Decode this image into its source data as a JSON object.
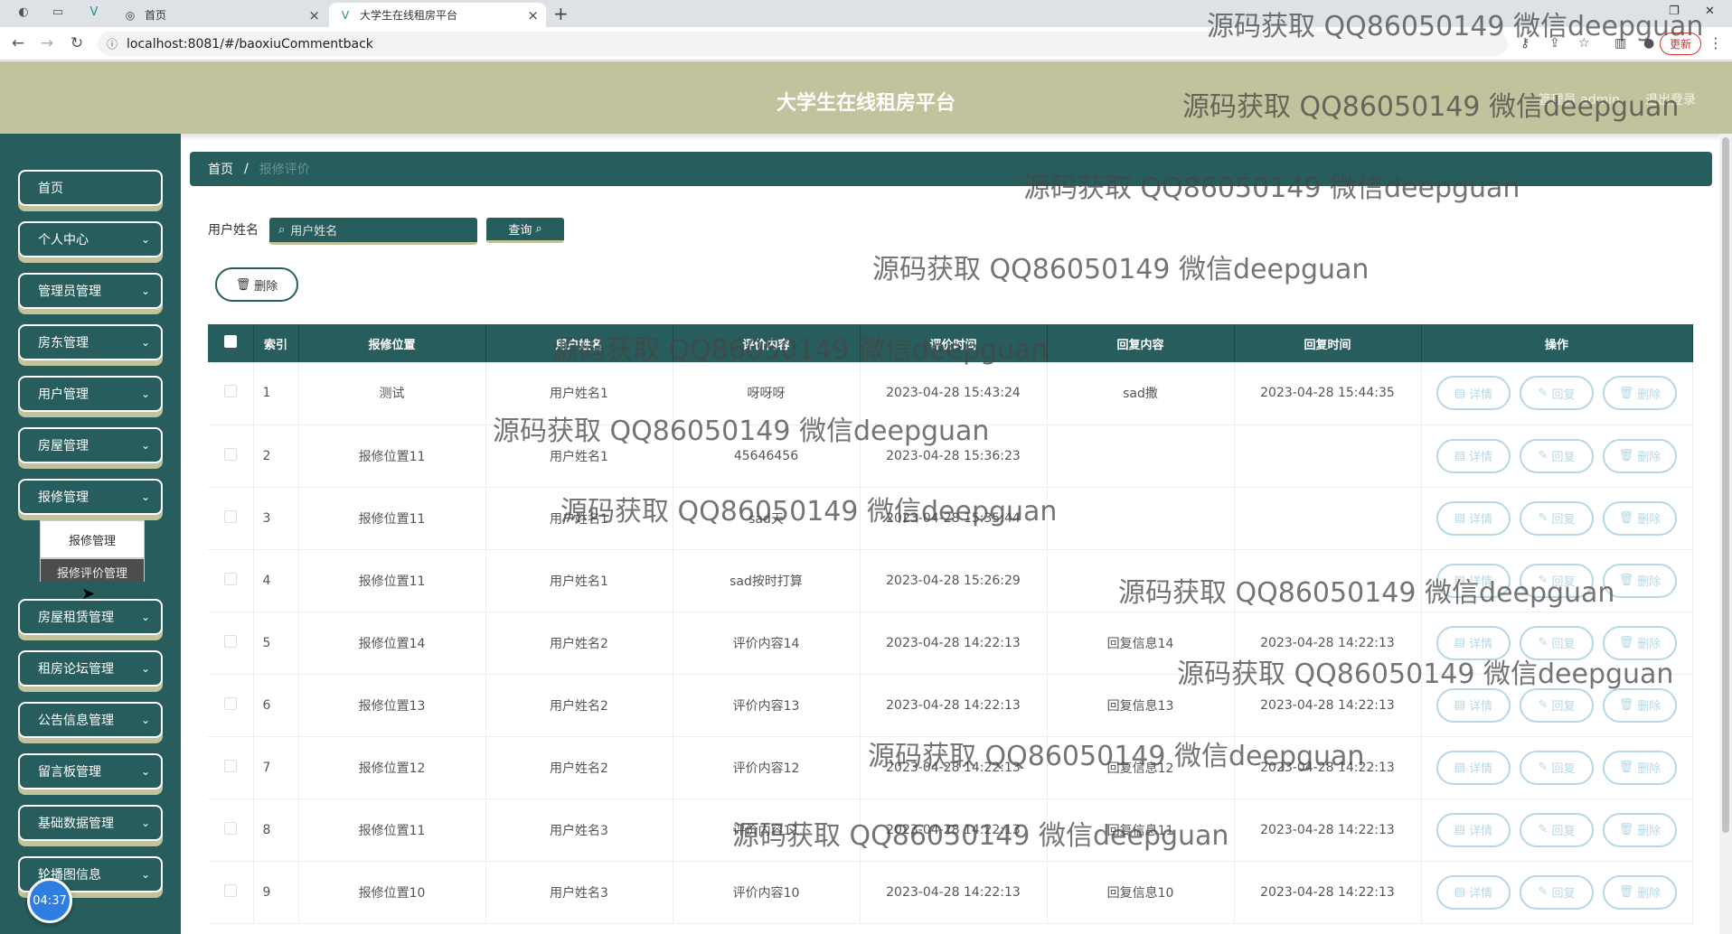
{
  "browser": {
    "tabs": [
      {
        "title": "首页",
        "active": false
      },
      {
        "title": "大学生在线租房平台",
        "active": true
      }
    ],
    "url": "localhost:8081/#/baoxiuCommentback",
    "update_label": "更新"
  },
  "header": {
    "title": "大学生在线租房平台",
    "links": [
      "管理员 admin",
      "退出登录"
    ]
  },
  "sidebar": {
    "items": [
      {
        "label": "首页",
        "has_arrow": false
      },
      {
        "label": "个人中心",
        "has_arrow": true
      },
      {
        "label": "管理员管理",
        "has_arrow": true
      },
      {
        "label": "房东管理",
        "has_arrow": true
      },
      {
        "label": "用户管理",
        "has_arrow": true
      },
      {
        "label": "房屋管理",
        "has_arrow": true
      },
      {
        "label": "报修管理",
        "has_arrow": true
      },
      {
        "label": "房屋租赁管理",
        "has_arrow": true
      },
      {
        "label": "租房论坛管理",
        "has_arrow": true
      },
      {
        "label": "公告信息管理",
        "has_arrow": true
      },
      {
        "label": "留言板管理",
        "has_arrow": true
      },
      {
        "label": "基础数据管理",
        "has_arrow": true
      },
      {
        "label": "轮播图信息",
        "has_arrow": true
      }
    ],
    "submenu": [
      "报修管理",
      "报修评价管理"
    ],
    "timer": "04:37"
  },
  "breadcrumb": {
    "home": "首页",
    "separator": "/",
    "current": "报修评价"
  },
  "search": {
    "label": "用户姓名",
    "placeholder": "用户姓名",
    "button": "查询"
  },
  "toolbar": {
    "delete_label": "删除"
  },
  "table": {
    "columns": [
      "索引",
      "报修位置",
      "用户姓名",
      "评价内容",
      "评价时间",
      "回复内容",
      "回复时间",
      "操作"
    ],
    "actions": [
      "详情",
      "回复",
      "删除"
    ],
    "rows": [
      {
        "idx": "1",
        "location": "测试",
        "user": "用户姓名1",
        "content": "呀呀呀",
        "time": "2023-04-28 15:43:24",
        "reply": "sad撒",
        "reply_time": "2023-04-28 15:44:35"
      },
      {
        "idx": "2",
        "location": "报修位置11",
        "user": "用户姓名1",
        "content": "45646456",
        "time": "2023-04-28 15:36:23",
        "reply": "",
        "reply_time": ""
      },
      {
        "idx": "3",
        "location": "报修位置11",
        "user": "用户姓名1",
        "content": "sad天",
        "time": "2023-04-28 15:35:44",
        "reply": "",
        "reply_time": ""
      },
      {
        "idx": "4",
        "location": "报修位置11",
        "user": "用户姓名1",
        "content": "sad按时打算",
        "time": "2023-04-28 15:26:29",
        "reply": "",
        "reply_time": ""
      },
      {
        "idx": "5",
        "location": "报修位置14",
        "user": "用户姓名2",
        "content": "评价内容14",
        "time": "2023-04-28 14:22:13",
        "reply": "回复信息14",
        "reply_time": "2023-04-28 14:22:13"
      },
      {
        "idx": "6",
        "location": "报修位置13",
        "user": "用户姓名2",
        "content": "评价内容13",
        "time": "2023-04-28 14:22:13",
        "reply": "回复信息13",
        "reply_time": "2023-04-28 14:22:13"
      },
      {
        "idx": "7",
        "location": "报修位置12",
        "user": "用户姓名2",
        "content": "评价内容12",
        "time": "2023-04-28 14:22:13",
        "reply": "回复信息12",
        "reply_time": "2023-04-28 14:22:13"
      },
      {
        "idx": "8",
        "location": "报修位置11",
        "user": "用户姓名3",
        "content": "评价内容11",
        "time": "2023-04-28 14:22:13",
        "reply": "回复信息11",
        "reply_time": "2023-04-28 14:22:13"
      },
      {
        "idx": "9",
        "location": "报修位置10",
        "user": "用户姓名3",
        "content": "评价内容10",
        "time": "2023-04-28 14:22:13",
        "reply": "回复信息10",
        "reply_time": "2023-04-28 14:22:13"
      }
    ]
  },
  "watermark": "源码获取 QQ86050149 微信deepguan",
  "colors": {
    "sidebar": "#285d5e",
    "header": "#c2c39c",
    "action_button": "#b6d8e4"
  }
}
